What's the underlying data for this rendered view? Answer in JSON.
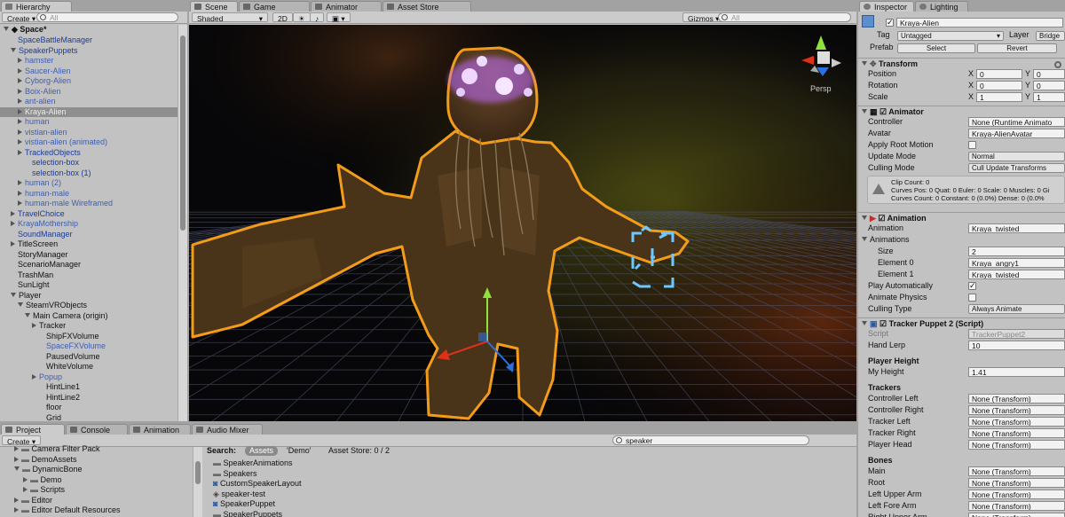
{
  "hierarchy": {
    "tab": "Hierarchy",
    "create": "Create",
    "search_placeholder": "All",
    "scene": "Space*",
    "items": [
      {
        "label": "SpaceBattleManager",
        "d": 1,
        "f": "",
        "c": "blue"
      },
      {
        "label": "SpeakerPuppets",
        "d": 1,
        "f": "open",
        "c": "blue"
      },
      {
        "label": "hamster",
        "d": 2,
        "f": "closed",
        "c": "lblue"
      },
      {
        "label": "Saucer-Alien",
        "d": 2,
        "f": "closed",
        "c": "lblue"
      },
      {
        "label": "Cyborg-Alien",
        "d": 2,
        "f": "closed",
        "c": "lblue"
      },
      {
        "label": "Boix-Alien",
        "d": 2,
        "f": "closed",
        "c": "lblue"
      },
      {
        "label": "ant-alien",
        "d": 2,
        "f": "closed",
        "c": "lblue"
      },
      {
        "label": "Kraya-Alien",
        "d": 2,
        "f": "closed",
        "c": "sel"
      },
      {
        "label": "human",
        "d": 2,
        "f": "closed",
        "c": "lblue"
      },
      {
        "label": "vistian-alien",
        "d": 2,
        "f": "closed",
        "c": "lblue"
      },
      {
        "label": "vistian-alien (animated)",
        "d": 2,
        "f": "closed",
        "c": "lblue"
      },
      {
        "label": "TrackedObjects",
        "d": 2,
        "f": "closed",
        "c": "blue"
      },
      {
        "label": "selection-box",
        "d": 3,
        "f": "",
        "c": "blue"
      },
      {
        "label": "selection-box (1)",
        "d": 3,
        "f": "",
        "c": "blue"
      },
      {
        "label": "human (2)",
        "d": 2,
        "f": "closed",
        "c": "lblue"
      },
      {
        "label": "human-male",
        "d": 2,
        "f": "closed",
        "c": "lblue"
      },
      {
        "label": "human-male Wireframed",
        "d": 2,
        "f": "closed",
        "c": "lblue"
      },
      {
        "label": "TravelChoice",
        "d": 1,
        "f": "closed",
        "c": "blue"
      },
      {
        "label": "KrayaMothership",
        "d": 1,
        "f": "closed",
        "c": "lblue"
      },
      {
        "label": "SoundManager",
        "d": 1,
        "f": "",
        "c": "blue"
      },
      {
        "label": "TitleScreen",
        "d": 1,
        "f": "closed",
        "c": ""
      },
      {
        "label": "StoryManager",
        "d": 1,
        "f": "",
        "c": ""
      },
      {
        "label": "ScenarioManager",
        "d": 1,
        "f": "",
        "c": ""
      },
      {
        "label": "TrashMan",
        "d": 1,
        "f": "",
        "c": ""
      },
      {
        "label": "SunLight",
        "d": 1,
        "f": "",
        "c": ""
      },
      {
        "label": "Player",
        "d": 1,
        "f": "open",
        "c": ""
      },
      {
        "label": "SteamVRObjects",
        "d": 2,
        "f": "open",
        "c": ""
      },
      {
        "label": "Main Camera (origin)",
        "d": 3,
        "f": "open",
        "c": ""
      },
      {
        "label": "Tracker",
        "d": 4,
        "f": "closed",
        "c": ""
      },
      {
        "label": "ShipFXVolume",
        "d": 5,
        "f": "",
        "c": ""
      },
      {
        "label": "SpaceFXVolume",
        "d": 5,
        "f": "",
        "c": "lblue"
      },
      {
        "label": "PausedVolume",
        "d": 5,
        "f": "",
        "c": ""
      },
      {
        "label": "WhiteVolume",
        "d": 5,
        "f": "",
        "c": ""
      },
      {
        "label": "Popup",
        "d": 4,
        "f": "closed",
        "c": "lblue"
      },
      {
        "label": "HintLine1",
        "d": 5,
        "f": "",
        "c": ""
      },
      {
        "label": "HintLine2",
        "d": 5,
        "f": "",
        "c": ""
      },
      {
        "label": "floor",
        "d": 5,
        "f": "",
        "c": ""
      },
      {
        "label": "Grid",
        "d": 5,
        "f": "",
        "c": ""
      }
    ]
  },
  "scene": {
    "tabs": [
      "Scene",
      "Game",
      "Animator",
      "Asset Store"
    ],
    "shaded": "Shaded",
    "mode2d": "2D",
    "gizmos": "Gizmos",
    "search_placeholder": "All",
    "persp": "Persp"
  },
  "inspector": {
    "tabs": [
      "Inspector",
      "Lighting"
    ],
    "object_name": "Kraya-Alien",
    "tag_label": "Tag",
    "tag": "Untagged",
    "layer_label": "Layer",
    "layer": "Bridge",
    "prefab_label": "Prefab",
    "select": "Select",
    "revert": "Revert",
    "transform": {
      "title": "Transform",
      "rows": [
        {
          "label": "Position",
          "x": "0",
          "y": "0"
        },
        {
          "label": "Rotation",
          "x": "0",
          "y": "0"
        },
        {
          "label": "Scale",
          "x": "1",
          "y": "1"
        }
      ]
    },
    "animator": {
      "title": "Animator",
      "controller_label": "Controller",
      "controller": "None (Runtime Animato",
      "avatar_label": "Avatar",
      "avatar": "Kraya-AlienAvatar",
      "root_motion": "Apply Root Motion",
      "update_mode_label": "Update Mode",
      "update_mode": "Normal",
      "culling_label": "Culling Mode",
      "culling": "Cull Update Transforms",
      "info": [
        "Clip Count: 0",
        "Curves Pos: 0 Quat: 0 Euler: 0 Scale: 0 Muscles: 0 Gi",
        "Curves Count: 0 Constant: 0 (0.0%) Dense: 0 (0.0%"
      ]
    },
    "animation": {
      "title": "Animation",
      "animation_label": "Animation",
      "animation": "Kraya_twisted",
      "animations_label": "Animations",
      "size_label": "Size",
      "size": "2",
      "el0_label": "Element 0",
      "el0": "Kraya_angry1",
      "el1_label": "Element 1",
      "el1": "Kraya_twisted",
      "play_auto": "Play Automatically",
      "physics": "Animate Physics",
      "culling_label": "Culling Type",
      "culling": "Always Animate"
    },
    "tracker": {
      "title": "Tracker Puppet 2 (Script)",
      "script_label": "Script",
      "script": "TrackerPuppet2",
      "hand_label": "Hand Lerp",
      "hand": "10",
      "ph_header": "Player Height",
      "height_label": "My Height",
      "height": "1.41",
      "trackers_header": "Trackers",
      "trackers": [
        {
          "label": "Controller Left",
          "value": "None (Transform)"
        },
        {
          "label": "Controller Right",
          "value": "None (Transform)"
        },
        {
          "label": "Tracker Left",
          "value": "None (Transform)"
        },
        {
          "label": "Tracker Right",
          "value": "None (Transform)"
        },
        {
          "label": "Player Head",
          "value": "None (Transform)"
        }
      ],
      "bones_header": "Bones",
      "bones": [
        {
          "label": "Main",
          "value": "None (Transform)"
        },
        {
          "label": "Root",
          "value": "None (Transform)"
        },
        {
          "label": "Left Upper Arm",
          "value": "None (Transform)"
        },
        {
          "label": "Left Fore Arm",
          "value": "None (Transform)"
        },
        {
          "label": "Right Upper Arm",
          "value": "None (Transform)"
        }
      ]
    }
  },
  "project": {
    "tabs": [
      "Project",
      "Console",
      "Animation",
      "Audio Mixer"
    ],
    "create": "Create",
    "search": "speaker",
    "search_label": "Search:",
    "scope_assets": "Assets",
    "scope_demo": "'Demo'",
    "asset_store": "Asset Store: 0 / 2",
    "tree": [
      {
        "label": "Camera Filter Pack",
        "d": 1
      },
      {
        "label": "DemoAssets",
        "d": 1
      },
      {
        "label": "DynamicBone",
        "d": 1,
        "open": true
      },
      {
        "label": "Demo",
        "d": 2
      },
      {
        "label": "Scripts",
        "d": 2
      },
      {
        "label": "Editor",
        "d": 1
      },
      {
        "label": "Editor Default Resources",
        "d": 1
      }
    ],
    "results": [
      {
        "label": "SpeakerAnimations",
        "icon": "folder"
      },
      {
        "label": "Speakers",
        "icon": "folder"
      },
      {
        "label": "CustomSpeakerLayout",
        "icon": "script"
      },
      {
        "label": "speaker-test",
        "icon": "scene"
      },
      {
        "label": "SpeakerPuppet",
        "icon": "script"
      },
      {
        "label": "SpeakerPuppets",
        "icon": "folder"
      }
    ]
  },
  "colors": {
    "outline": "#f39c1a",
    "glow": "#c06cff",
    "grid": "#4a5068",
    "selected": "#8f8f8f"
  }
}
